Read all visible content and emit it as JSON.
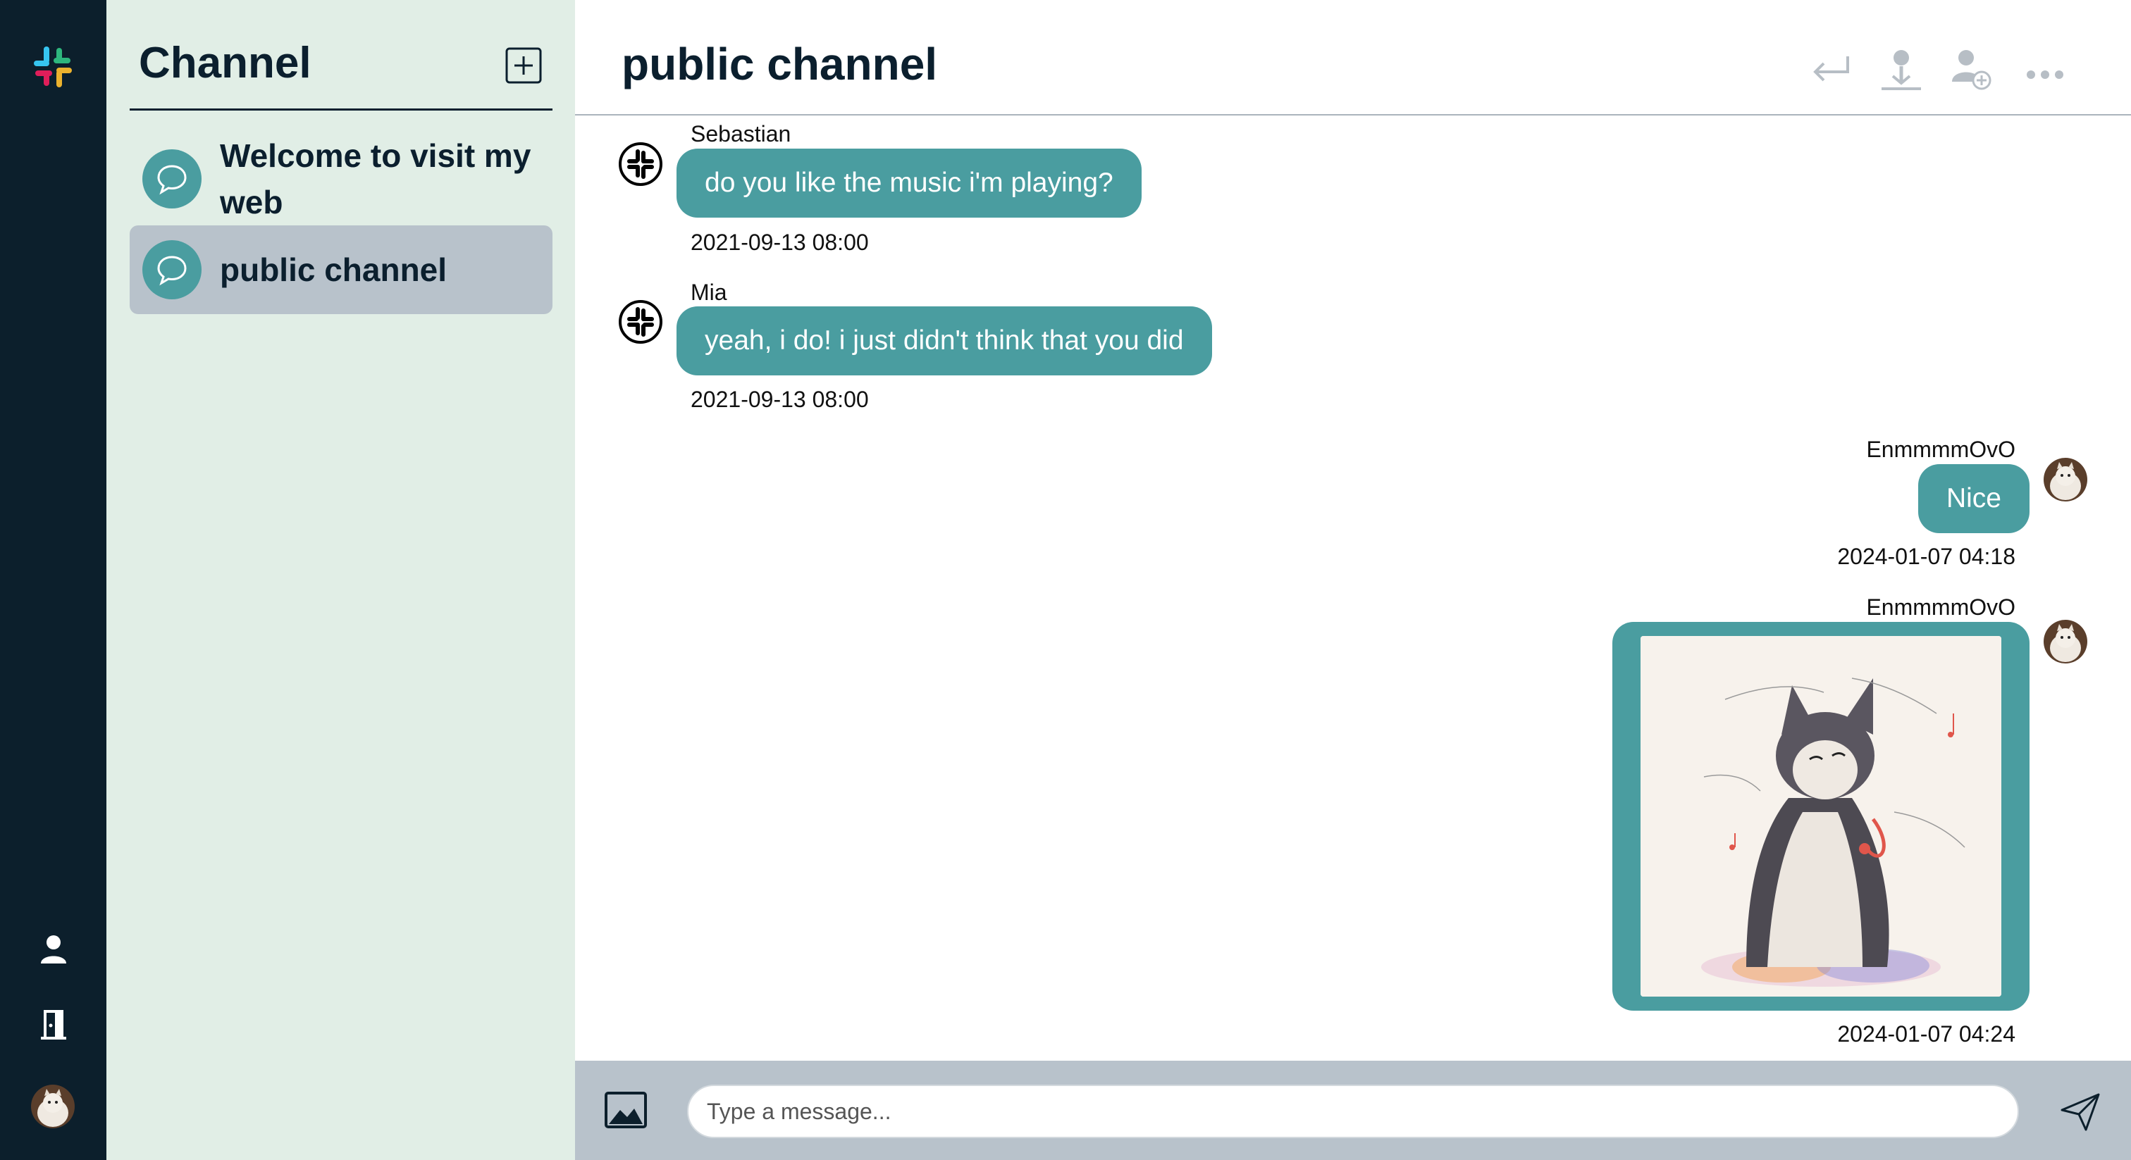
{
  "sidebar": {
    "title": "Channel",
    "channels": [
      {
        "label": "Welcome to visit my web",
        "active": false,
        "icon": "chat-bubble-icon"
      },
      {
        "label": "public channel",
        "active": true,
        "icon": "chat-bubble-icon"
      }
    ]
  },
  "header": {
    "title": "public channel",
    "actions": [
      "return-arrow-icon",
      "user-stand-icon",
      "add-user-icon",
      "more-dots-icon"
    ]
  },
  "messages": [
    {
      "sender": "Sebastian",
      "text": "do you like the music i'm playing?",
      "time": "2021-09-13 08:00",
      "side": "left"
    },
    {
      "sender": "Mia",
      "text": "yeah, i do! i just didn't think that you did",
      "time": "2021-09-13 08:00",
      "side": "left"
    },
    {
      "sender": "EnmmmmOvO",
      "text": "Nice",
      "time": "2024-01-07 04:18",
      "side": "right"
    },
    {
      "sender": "EnmmmmOvO",
      "image": "singing-cat-illustration",
      "time": "2024-01-07 04:24",
      "side": "right"
    }
  ],
  "composer": {
    "placeholder": "Type a message..."
  },
  "colors": {
    "rail": "#0c1f2c",
    "sidebar": "#e1eee6",
    "accent": "#4a9da0",
    "active_item": "#b8c2cb",
    "composer_bar": "#b8c2cb"
  }
}
